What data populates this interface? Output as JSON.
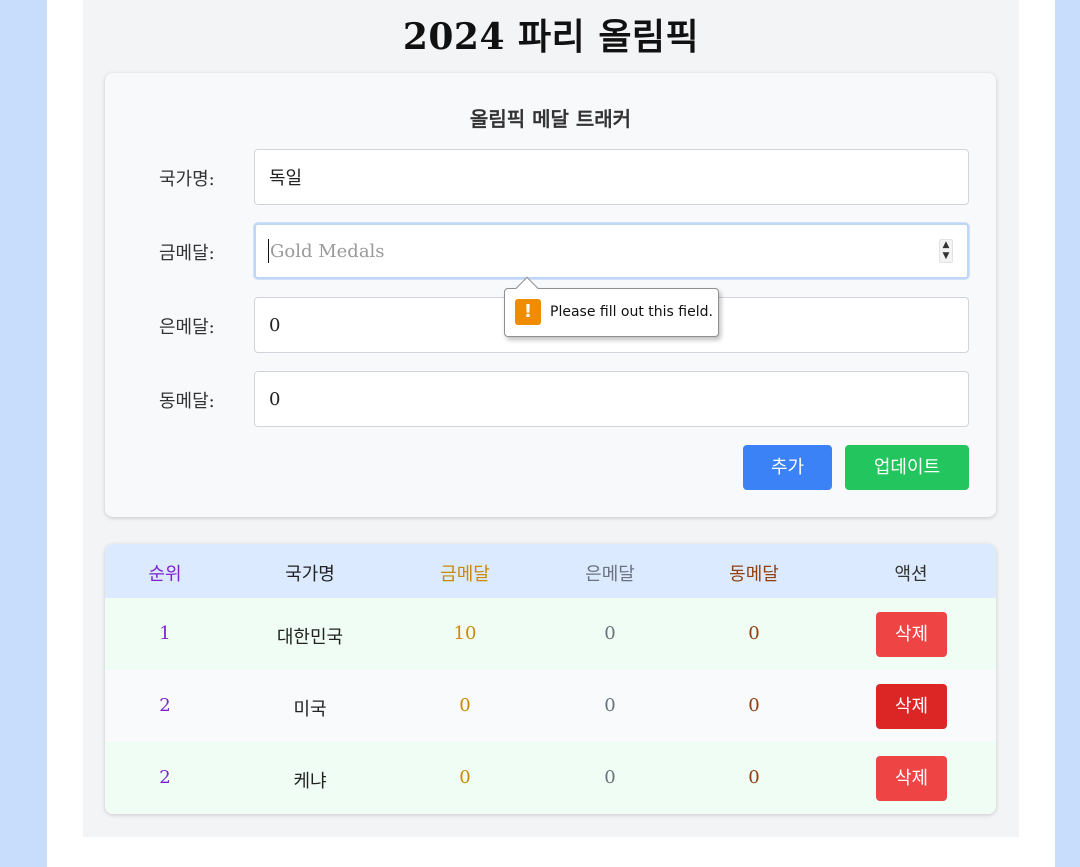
{
  "title": "2024 파리 올림픽",
  "form": {
    "heading": "올림픽 메달 트래커",
    "country_label": "국가명:",
    "country_value": "독일",
    "gold_label": "금메달:",
    "gold_placeholder": "Gold Medals",
    "silver_label": "은메달:",
    "silver_value": "0",
    "bronze_label": "동메달:",
    "bronze_value": "0",
    "add_label": "추가",
    "update_label": "업데이트",
    "validation_message": "Please fill out this field."
  },
  "table": {
    "headers": [
      "순위",
      "국가명",
      "금메달",
      "은메달",
      "동메달",
      "액션"
    ],
    "rows": [
      {
        "rank": "1",
        "country": "대한민국",
        "gold": "10",
        "silver": "0",
        "bronze": "0",
        "action": "삭제"
      },
      {
        "rank": "2",
        "country": "미국",
        "gold": "0",
        "silver": "0",
        "bronze": "0",
        "action": "삭제"
      },
      {
        "rank": "2",
        "country": "케냐",
        "gold": "0",
        "silver": "0",
        "bronze": "0",
        "action": "삭제"
      }
    ]
  },
  "colors": {
    "add_button": "#3b82f6",
    "update_button": "#22c55e",
    "delete_button": "#ef4444",
    "rank": "#7e22ce",
    "gold": "#ca8a04",
    "silver": "#6b7280",
    "bronze": "#92400e"
  }
}
